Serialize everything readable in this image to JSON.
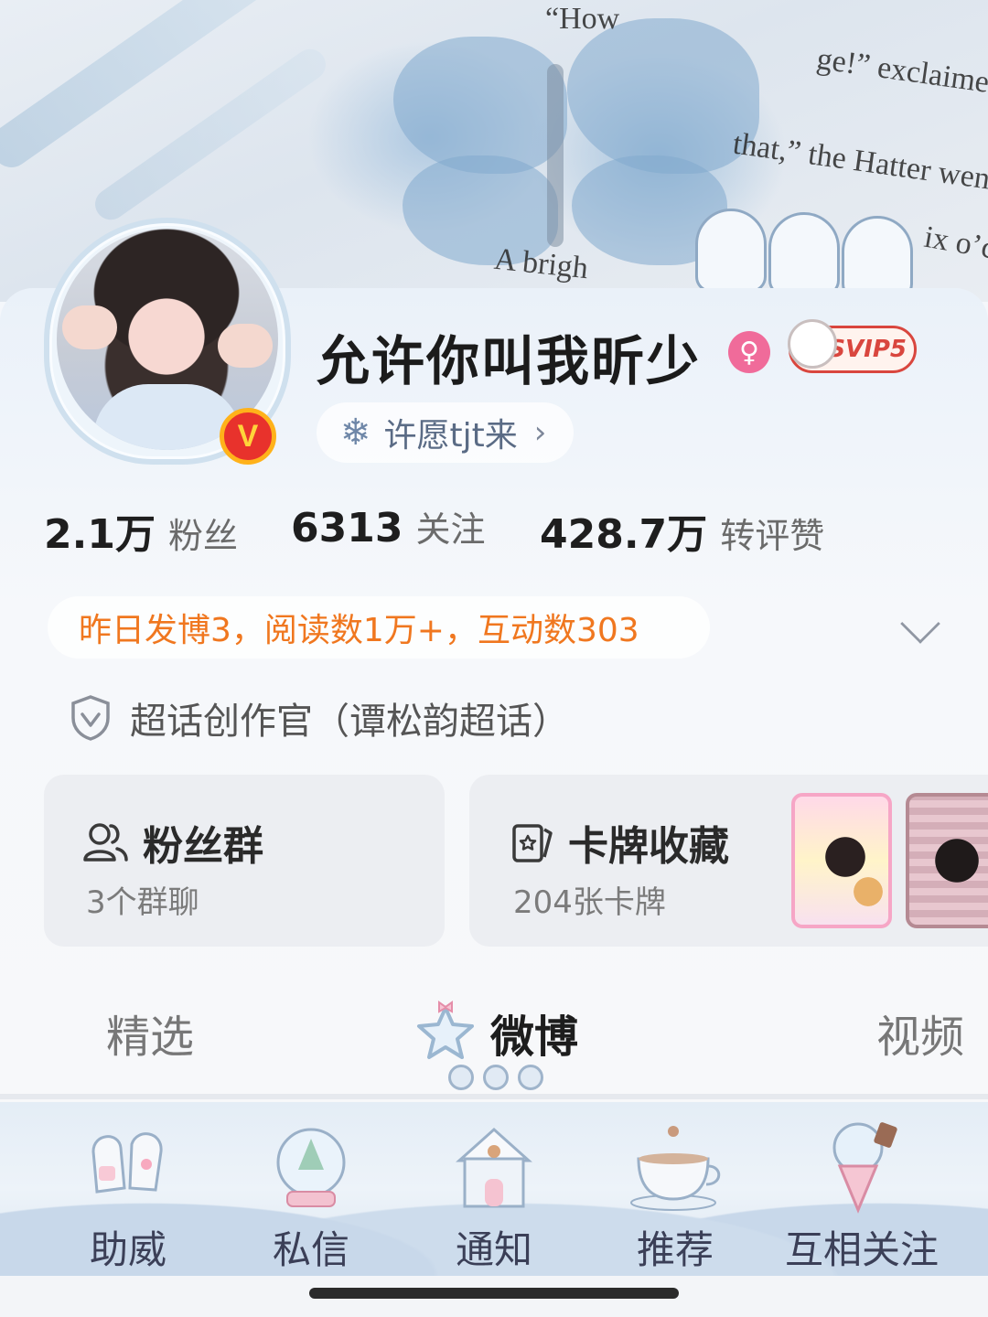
{
  "cover": {
    "book_lines": [
      "“How",
      "ge!” exclaimed",
      "that,” the Hatter wen",
      "ix o’cl",
      "A brigh"
    ]
  },
  "profile": {
    "username": "允许你叫我昕少",
    "verified_badge": "V",
    "gender_symbol": "♀",
    "svip_label": "SVIP5",
    "wish_label": "许愿tjt来",
    "wish_chevron": "›",
    "snow_glyph": "❄"
  },
  "stats": [
    {
      "value": "2.1万",
      "label": "粉丝"
    },
    {
      "value": "6313",
      "label": "关注"
    },
    {
      "value": "428.7万",
      "label": "转评赞"
    }
  ],
  "activity": {
    "text": "昨日发博3，阅读数1万+，互动数303"
  },
  "supertopic": {
    "text": "超话创作官（谭松韵超话）"
  },
  "cards": {
    "fans_group": {
      "title": "粉丝群",
      "subtitle": "3个群聊"
    },
    "card_collection": {
      "title": "卡牌收藏",
      "subtitle": "204张卡牌"
    }
  },
  "tabs": [
    {
      "label": "精选"
    },
    {
      "label": "微博"
    },
    {
      "label": "视频"
    }
  ],
  "bottom_nav": [
    {
      "label": "助威",
      "icon": "mittens-icon"
    },
    {
      "label": "私信",
      "icon": "snow-globe-icon"
    },
    {
      "label": "通知",
      "icon": "gingerbread-house-icon"
    },
    {
      "label": "推荐",
      "icon": "teacup-icon"
    },
    {
      "label": "互相关注",
      "icon": "ice-cream-icon"
    }
  ],
  "colors": {
    "accent_orange": "#f0771f",
    "verified_red": "#e8322c",
    "gender_pink": "#f06b9a",
    "svip_red": "#d9463e"
  }
}
